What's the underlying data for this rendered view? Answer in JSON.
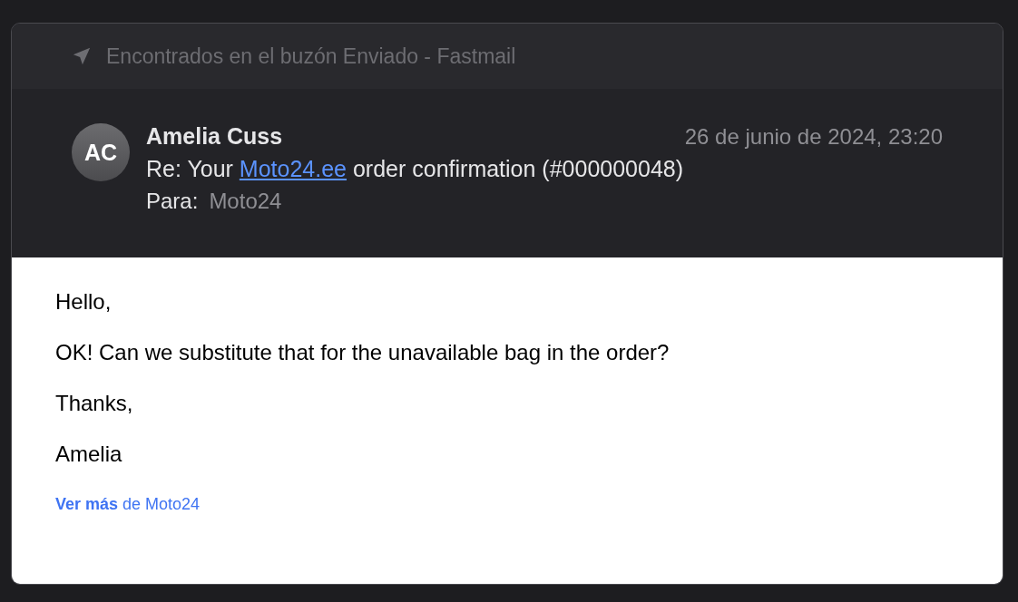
{
  "source_bar": {
    "text": "Encontrados en el buzón Enviado - Fastmail"
  },
  "message": {
    "avatar_initials": "AC",
    "sender": "Amelia Cuss",
    "date": "26 de junio de 2024, 23:20",
    "subject": {
      "before": "Re: Your ",
      "link": "Moto24.ee",
      "after": " order confirmation (#000000048)"
    },
    "to_label": "Para:",
    "to_value": "Moto24"
  },
  "body": [
    "Hello,",
    "OK! Can we substitute that for the unavailable bag in the order?",
    "Thanks,",
    "Amelia"
  ],
  "more_link": "**Ver más** de Moto24"
}
